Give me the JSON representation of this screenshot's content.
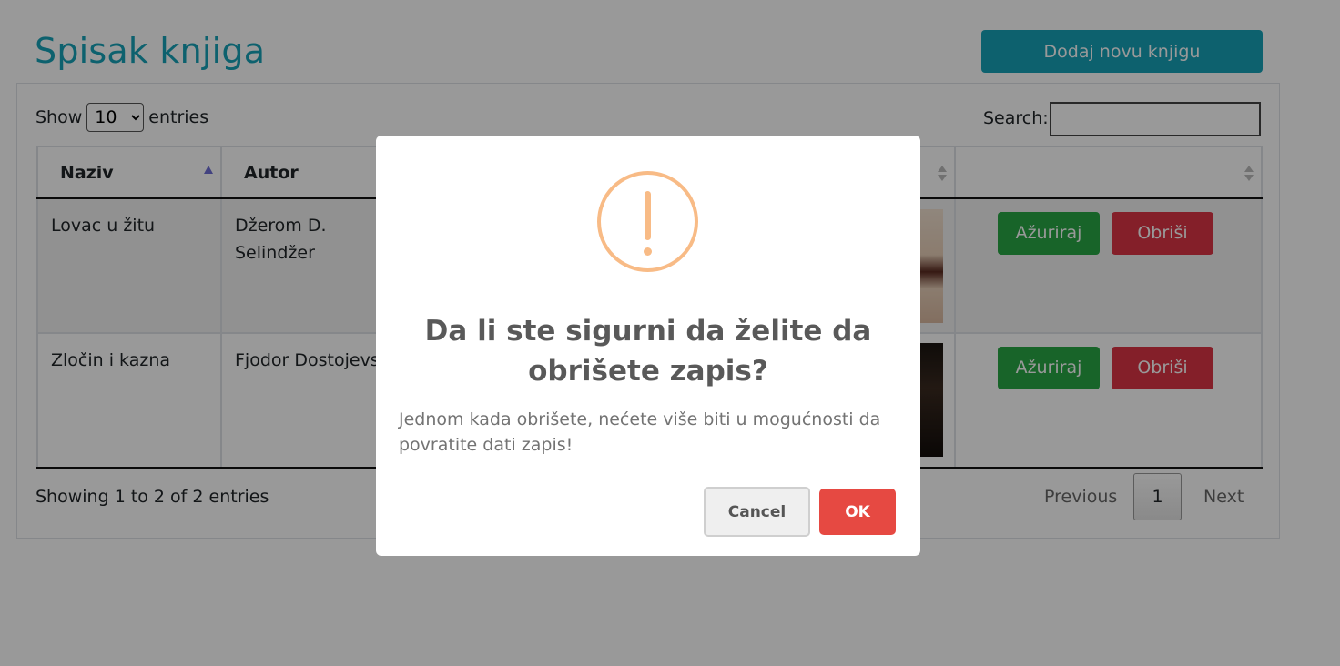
{
  "header": {
    "title": "Spisak knjiga",
    "add_button_label": "Dodaj novu knjigu"
  },
  "table_controls": {
    "show_label": "Show",
    "entries_value": "10",
    "entries_label": "entries",
    "search_label": "Search:",
    "search_value": ""
  },
  "table": {
    "columns": [
      "Naziv",
      "Autor"
    ],
    "rows": [
      {
        "naziv": "Lovac u žitu",
        "autor": "Džerom D. Selindžer",
        "update_label": "Ažuriraj",
        "delete_label": "Obriši"
      },
      {
        "naziv": "Zločin i kazna",
        "autor": "Fjodor Dostojevski",
        "update_label": "Ažuriraj",
        "delete_label": "Obriši"
      }
    ]
  },
  "footer": {
    "showing_text": "Showing 1 to 2 of 2 entries",
    "previous_label": "Previous",
    "current_page": "1",
    "next_label": "Next"
  },
  "modal": {
    "title": "Da li ste sigurni da želite da obrišete zapis?",
    "text": "Jednom kada obrišete, nećete više biti u mogućnosti da povratite dati zapis!",
    "cancel_label": "Cancel",
    "ok_label": "OK",
    "icon": "warning-icon"
  },
  "colors": {
    "accent": "#17a2b8",
    "success": "#28a745",
    "danger": "#dc3545",
    "warning_icon": "#f8bb86",
    "ok_button": "#e64942"
  }
}
